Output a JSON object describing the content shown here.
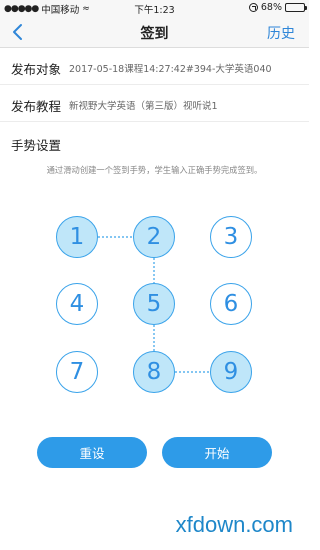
{
  "status_bar": {
    "signal_dots": "●●●●●",
    "carrier": "中国移动",
    "wifi": "≈",
    "time": "下午1:23",
    "battery": "68%",
    "battery_level": 0.68
  },
  "nav": {
    "title": "签到",
    "history": "历史"
  },
  "form": {
    "target_label": "发布对象",
    "target_value": "2017-05-18课程14:27:42#394-大学英语040",
    "tutorial_label": "发布教程",
    "tutorial_value": "新视野大学英语（第三版）视听说1"
  },
  "gesture": {
    "title": "手势设置",
    "hint": "通过滑动创建一个签到手势，学生输入正确手势完成签到。",
    "points": [
      {
        "label": "1",
        "selected": true
      },
      {
        "label": "2",
        "selected": true
      },
      {
        "label": "3",
        "selected": false
      },
      {
        "label": "4",
        "selected": false
      },
      {
        "label": "5",
        "selected": true
      },
      {
        "label": "6",
        "selected": false
      },
      {
        "label": "7",
        "selected": false
      },
      {
        "label": "8",
        "selected": true
      },
      {
        "label": "9",
        "selected": true
      }
    ],
    "path": [
      "1",
      "2",
      "5",
      "8",
      "9"
    ]
  },
  "buttons": {
    "reset": "重设",
    "start": "开始"
  },
  "watermark": "xfdown.com",
  "colors": {
    "accent": "#2e9be8",
    "selected_fill": "#bfe6f9",
    "history_link": "#2f86d8"
  }
}
